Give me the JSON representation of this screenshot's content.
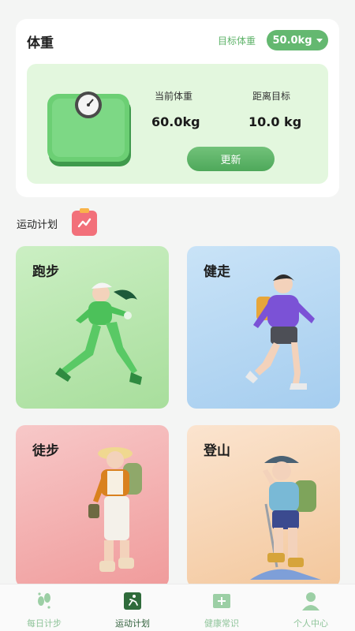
{
  "weight": {
    "title": "体重",
    "target_label": "目标体重",
    "target_value": "50.0kg",
    "current_label": "当前体重",
    "current_value": "60.0kg",
    "distance_label": "距离目标",
    "distance_value": "10.0 kg",
    "update_label": "更新"
  },
  "plan": {
    "title": "运动计划",
    "cards": [
      {
        "label": "跑步"
      },
      {
        "label": "健走"
      },
      {
        "label": "徒步"
      },
      {
        "label": "登山"
      }
    ]
  },
  "tabs": [
    {
      "label": "每日计步",
      "icon": "footprint-icon",
      "active": false
    },
    {
      "label": "运动计划",
      "icon": "running-plan-icon",
      "active": true
    },
    {
      "label": "健康常识",
      "icon": "book-plus-icon",
      "active": false
    },
    {
      "label": "个人中心",
      "icon": "person-icon",
      "active": false
    }
  ],
  "colors": {
    "accent": "#64b870",
    "panel": "#e3f7de",
    "tab_inactive": "#8fc49a",
    "tab_active": "#2d5e38"
  }
}
